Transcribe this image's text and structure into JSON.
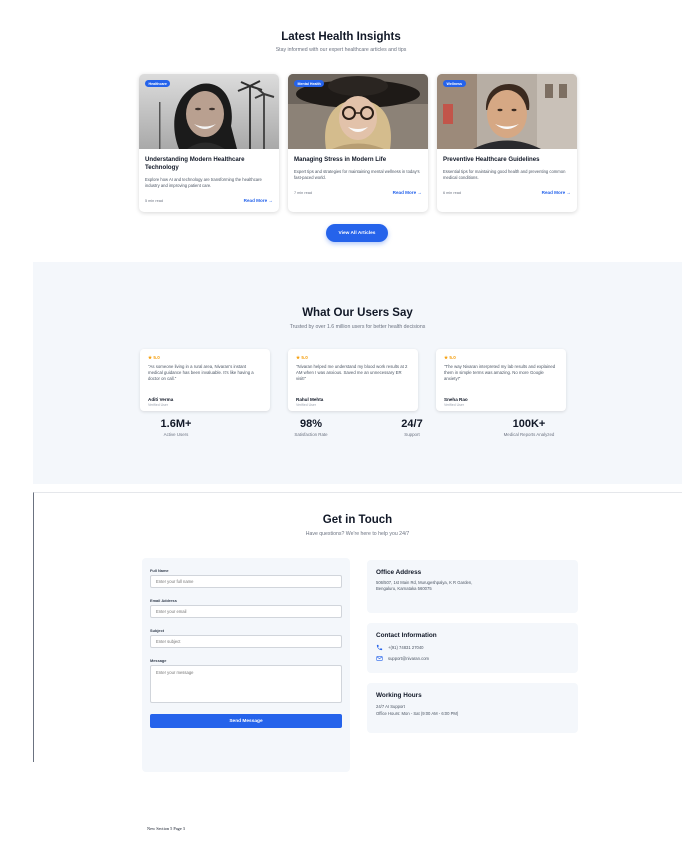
{
  "insights": {
    "title": "Latest Health Insights",
    "subtitle": "Stay informed with our expert healthcare articles and tips",
    "cards": [
      {
        "badge": "Healthcare",
        "title": "Understanding Modern Healthcare Technology",
        "description": "Explore how AI and technology are transforming the healthcare industry and improving patient care.",
        "read_time": "5 min read",
        "link": "Read More →",
        "image": "smiling-woman-palm-trees-photo"
      },
      {
        "badge": "Mental Health",
        "title": "Managing Stress in Modern Life",
        "description": "Expert tips and strategies for maintaining mental wellness in today's fast-paced world.",
        "read_time": "7 min read",
        "link": "Read More →",
        "image": "smiling-woman-hat-glasses-photo"
      },
      {
        "badge": "Wellness",
        "title": "Preventive Healthcare Guidelines",
        "description": "Essential tips for maintaining good health and preventing common medical conditions.",
        "read_time": "6 min read",
        "link": "Read More →",
        "image": "smiling-man-street-photo"
      }
    ],
    "view_all_label": "View All Articles",
    "accent_color": "#2563eb"
  },
  "testimonials": {
    "title": "What Our Users Say",
    "subtitle": "Trusted by over 1.6 million users for better health decisions",
    "reviews": [
      {
        "rating": "★ 5.0",
        "quote": "\"As someone living in a rural area, Nivaran's instant medical guidance has been invaluable. It's like having a doctor on call.\"",
        "name": "Aditi Verma",
        "role": "Verified User"
      },
      {
        "rating": "★ 5.0",
        "quote": "\"Nivaran helped me understand my blood work results at 2 AM when I was anxious. Saved me an unnecessary ER visit!\"",
        "name": "Rahul Mehta",
        "role": "Verified User"
      },
      {
        "rating": "★ 5.0",
        "quote": "\"The way Nivaran interpreted my lab results and explained them in simple terms was amazing. No more Google anxiety!\"",
        "name": "Sneha Rao",
        "role": "Verified User"
      }
    ],
    "stats": [
      {
        "value": "1.6M+",
        "label": "Active Users"
      },
      {
        "value": "98%",
        "label": "Satisfaction Rate"
      },
      {
        "value": "24/7",
        "label": "Support"
      },
      {
        "value": "100K+",
        "label": "Medical Reports Analyzed"
      }
    ],
    "star_color": "#f59e0b"
  },
  "contact": {
    "title": "Get in Touch",
    "subtitle": "Have questions? We're here to help you 24/7",
    "form": {
      "full_name_label": "Full Name",
      "full_name_placeholder": "Enter your full name",
      "email_label": "Email Address",
      "email_placeholder": "Enter your email",
      "subject_label": "Subject",
      "subject_placeholder": "Enter subject",
      "message_label": "Message",
      "message_placeholder": "Enter your message",
      "submit_label": "Send Message"
    },
    "office": {
      "title": "Office Address",
      "lines": "506/507, 1st Main Rd, Murugeshpalya, K R Garden, Bengaluru, Karnataka 560075"
    },
    "info": {
      "title": "Contact Information",
      "phone": "+(91) 74831 27040",
      "email": "support@nivaran.com",
      "phone_icon": "phone-icon",
      "email_icon": "mail-icon"
    },
    "hours": {
      "title": "Working Hours",
      "line1": "24/7 AI Support",
      "line2": "Office Hours: Mon - Sat (9:00 AM - 6:00 PM)"
    }
  },
  "footer": {
    "note": "New Section 5 Page 3"
  }
}
